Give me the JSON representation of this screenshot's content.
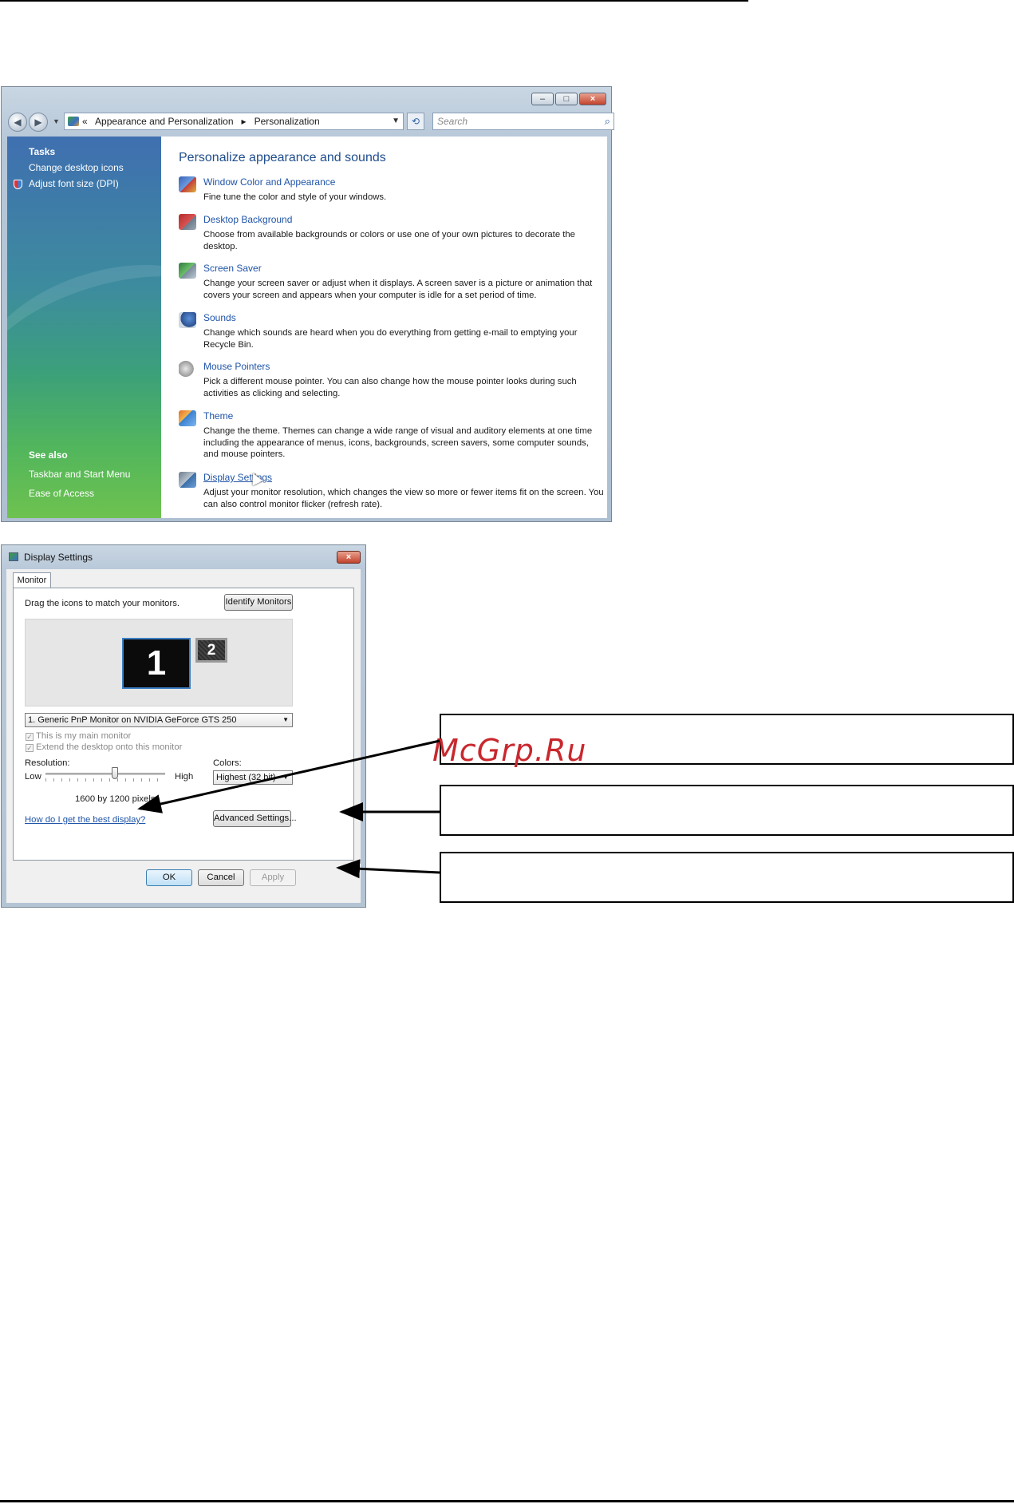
{
  "control_panel": {
    "breadcrumb_prefix": "«",
    "breadcrumb": [
      "Appearance and Personalization",
      "Personalization"
    ],
    "breadcrumb_sep": "▸",
    "search_placeholder": "Search",
    "window_buttons": [
      "–",
      "□",
      "×"
    ],
    "sidebar": {
      "tasks_heading": "Tasks",
      "tasks": [
        "Change desktop icons",
        "Adjust font size (DPI)"
      ],
      "see_also_heading": "See also",
      "see_also": [
        "Taskbar and Start Menu",
        "Ease of Access"
      ]
    },
    "main_title": "Personalize appearance and sounds",
    "items": [
      {
        "title": "Window Color and Appearance",
        "desc": "Fine tune the color and style of your windows.",
        "icon": "window-color-icon"
      },
      {
        "title": "Desktop Background",
        "desc": "Choose from available backgrounds or colors or use one of your own pictures to decorate the desktop.",
        "icon": "desktop-background-icon"
      },
      {
        "title": "Screen Saver",
        "desc": "Change your screen saver or adjust when it displays. A screen saver is a picture or animation that covers your screen and appears when your computer is idle for a set period of time.",
        "icon": "screen-saver-icon"
      },
      {
        "title": "Sounds",
        "desc": "Change which sounds are heard when you do everything from getting e-mail to emptying your Recycle Bin.",
        "icon": "sounds-icon"
      },
      {
        "title": "Mouse Pointers",
        "desc": "Pick a different mouse pointer. You can also change how the mouse pointer looks during such activities as clicking and selecting.",
        "icon": "mouse-pointers-icon"
      },
      {
        "title": "Theme",
        "desc": "Change the theme. Themes can change a wide range of visual and auditory elements at one time including the appearance of menus, icons, backgrounds, screen savers, some computer sounds, and mouse pointers.",
        "icon": "theme-icon"
      },
      {
        "title": "Display Settings",
        "desc": "Adjust your monitor resolution, which changes the view so more or fewer items fit on the screen. You can also control monitor flicker (refresh rate).",
        "icon": "display-settings-icon"
      }
    ]
  },
  "display_settings": {
    "title": "Display Settings",
    "close": "×",
    "tab": "Monitor",
    "instruction": "Drag the icons to match your monitors.",
    "identify_button": "Identify Monitors",
    "monitor1_label": "1",
    "monitor2_label": "2",
    "monitor_select": "1. Generic PnP Monitor on NVIDIA GeForce GTS 250",
    "checkbox_main": "This is my main monitor",
    "checkbox_extend": "Extend the desktop onto this monitor",
    "check_mark": "✓",
    "resolution_label": "Resolution:",
    "low_label": "Low",
    "high_label": "High",
    "resolution_level": 0.58,
    "resolution_value": "1600 by 1200 pixels",
    "colors_label": "Colors:",
    "colors_value": "Highest (32 bit)",
    "help_link": "How do I get the best display?",
    "advanced_button": "Advanced Settings...",
    "ok_button": "OK",
    "cancel_button": "Cancel",
    "apply_button": "Apply"
  },
  "watermark": "McGrp.Ru"
}
